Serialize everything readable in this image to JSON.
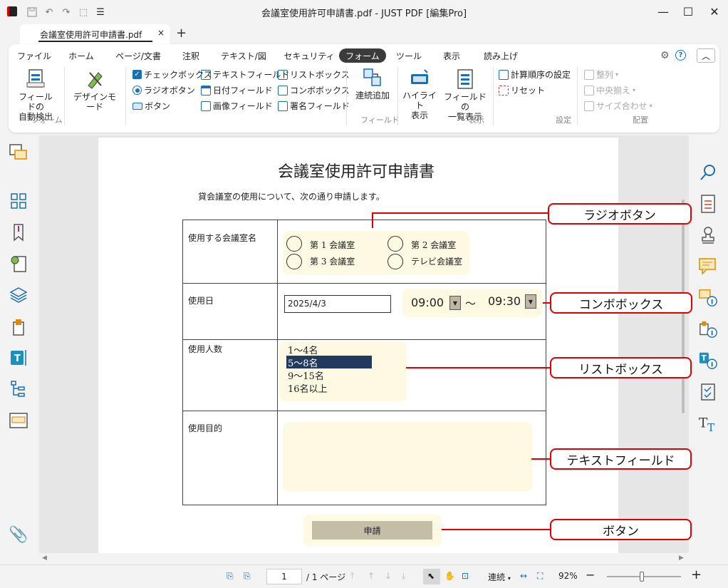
{
  "window": {
    "title": "会議室使用許可申請書.pdf - JUST PDF [編集Pro]",
    "minimize": "—",
    "maximize": "☐",
    "close": "✕"
  },
  "tabbar": {
    "tab_label": "会議室使用許可申請書.pdf",
    "tab_close": "×",
    "new_tab": "+"
  },
  "ribbon": {
    "tabs": [
      "ファイル",
      "ホーム",
      "ページ/文書",
      "注釈",
      "テキスト/図",
      "セキュリティ",
      "フォーム",
      "ツール",
      "表示",
      "読み上げ"
    ],
    "active_tab": "フォーム",
    "help": "?",
    "collapse": "︿",
    "auto_detect": "フィールドの\n自動検出",
    "group_form": "フォーム",
    "design_mode": "デザインモード",
    "checkbox": "チェックボックス",
    "radio_button": "ラジオボタン",
    "button": "ボタン",
    "text_field": "テキストフィールド",
    "date_field": "日付フィールド",
    "image_field": "画像フィールド",
    "list_box": "リストボックス",
    "combo_box": "コンボボックス",
    "signature_field": "署名フィールド",
    "continuous_add": "連続追加",
    "group_field": "フィールド",
    "highlight": "ハイライト\n表示",
    "field_list": "フィールドの\n一覧表示",
    "group_view": "表示",
    "calc_order": "計算順序の設定",
    "reset": "リセット",
    "group_settings": "設定",
    "align": "整列",
    "center_align": "中央揃え",
    "size_match": "サイズ合わせ",
    "group_arrange": "配置"
  },
  "document": {
    "title": "会議室使用許可申請書",
    "intro": "貸会議室の使用について、次の通り申請します。",
    "rows": {
      "room_label": "使用する会議室名",
      "date_label": "使用日",
      "people_label": "使用人数",
      "purpose_label": "使用目的"
    },
    "rooms": [
      "第 1 会議室",
      "第 2 会議室",
      "第 3 会議室",
      "テレビ会議室"
    ],
    "date_value": "2025/4/3",
    "time_from": "09:00",
    "time_sep": "～",
    "time_to": "09:30",
    "people_options": [
      "1～4名",
      "5～8名",
      "9～15名",
      "16名以上"
    ],
    "people_selected": 1,
    "submit_label": "申請"
  },
  "callouts": {
    "radio": "ラジオボタン",
    "combo": "コンボボックス",
    "list": "リストボックス",
    "text": "テキストフィールド",
    "button": "ボタン"
  },
  "statusbar": {
    "page_current": "1",
    "page_total": "/ 1 ページ",
    "view_mode": "連続",
    "zoom": "92%",
    "zoom_out": "−",
    "zoom_in": "+",
    "zoom_level": 0.47
  },
  "colors": {
    "accent": "#1a6fb5",
    "field_bg": "#fdf9e3",
    "callout": "#e00000",
    "selection": "#223a5e"
  }
}
